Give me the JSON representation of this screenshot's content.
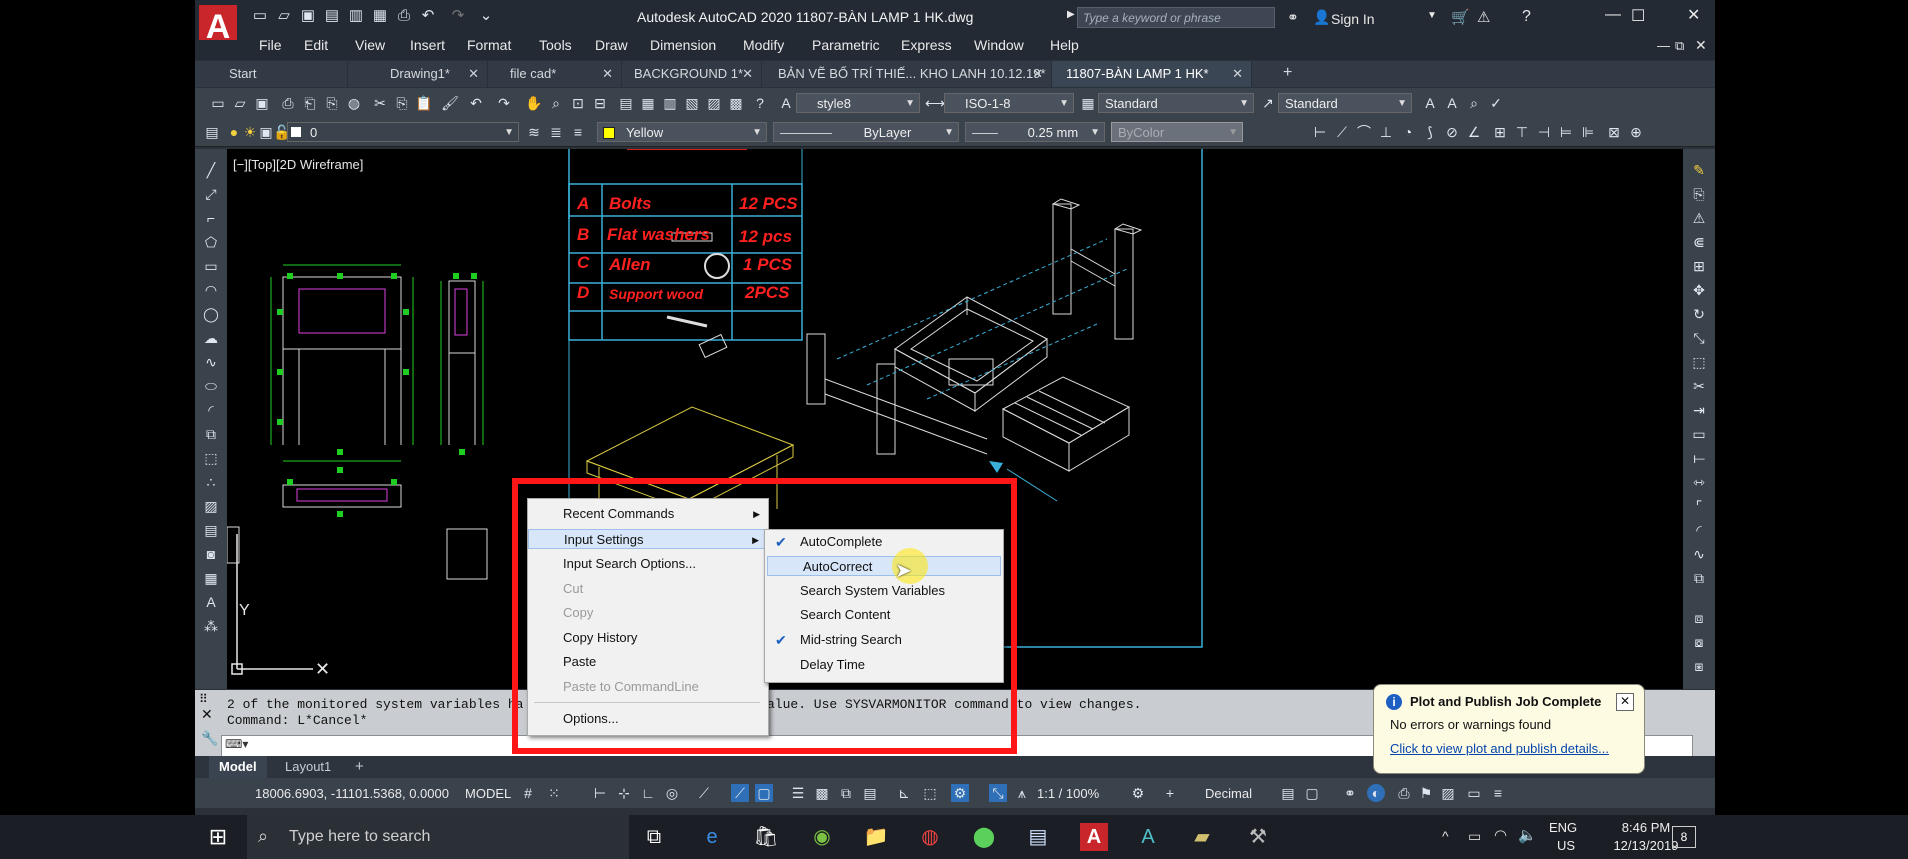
{
  "window": {
    "title": "Autodesk AutoCAD 2020    11807-BÀN LAMP 1 HK.dwg",
    "search_placeholder": "Type a keyword or phrase",
    "sign_in": "Sign In"
  },
  "menu": [
    "File",
    "Edit",
    "View",
    "Insert",
    "Format",
    "Tools",
    "Draw",
    "Dimension",
    "Modify",
    "Parametric",
    "Express",
    "Window",
    "Help"
  ],
  "doc_tabs": [
    {
      "label": "Start"
    },
    {
      "label": "Drawing1*"
    },
    {
      "label": "file cad*"
    },
    {
      "label": "BACKGROUND 1*"
    },
    {
      "label": "BẢN VẼ BỐ TRÍ THIẾ... KHO LANH 10.12.19*"
    },
    {
      "label": "11807-BÀN LAMP 1 HK*"
    }
  ],
  "toolbar": {
    "text_style": "style8",
    "dim_style": "ISO-1-8",
    "table_style": "Standard",
    "multileader_style": "Standard",
    "layer": "0",
    "color": "Yellow",
    "linetype": "ByLayer",
    "lineweight": "0.25 mm",
    "plotstyle": "ByColor"
  },
  "viewport_label": "[−][Top][2D Wireframe]",
  "parts_table": [
    {
      "key": "A",
      "name": "Bolts",
      "qty": "12 PCS"
    },
    {
      "key": "B",
      "name": "Flat washers",
      "qty": "12 pcs"
    },
    {
      "key": "C",
      "name": "Allen",
      "qty": "1 PCS"
    },
    {
      "key": "D",
      "name": "Support wood",
      "qty": "2PCS"
    }
  ],
  "context_menu": {
    "items": [
      {
        "label": "Recent Commands",
        "submenu": true
      },
      {
        "label": "Input Settings",
        "submenu": true
      },
      {
        "label": "Input Search Options..."
      },
      {
        "label": "Cut",
        "disabled": true
      },
      {
        "label": "Copy",
        "disabled": true
      },
      {
        "label": "Copy History"
      },
      {
        "label": "Paste"
      },
      {
        "label": "Paste to CommandLine",
        "disabled": true
      },
      {
        "label": "Options..."
      }
    ],
    "submenu": [
      {
        "label": "AutoComplete",
        "checked": true
      },
      {
        "label": "AutoCorrect",
        "highlighted": true
      },
      {
        "label": "Search System Variables"
      },
      {
        "label": "Search Content"
      },
      {
        "label": "Mid-string Search",
        "checked": true
      },
      {
        "label": "Delay Time"
      }
    ]
  },
  "command_line": {
    "line1a": "2 of the monitored system variables ha",
    "line1b": "alue. Use SYSVARMONITOR command to view changes.",
    "line2": "Command: L*Cancel*"
  },
  "layout_tabs": [
    "Model",
    "Layout1"
  ],
  "status": {
    "coordinates": "18006.6903, -11101.5368, 0.0000",
    "space": "MODEL",
    "scale": "1:1 / 100%",
    "units": "Decimal"
  },
  "notification": {
    "title": "Plot and Publish Job Complete",
    "text": "No errors or warnings found",
    "link": "Click to view plot and publish details..."
  },
  "taskbar": {
    "search_placeholder": "Type here to search",
    "lang1": "ENG",
    "lang2": "US",
    "time": "8:46 PM",
    "date": "12/13/2019",
    "notif_count": "8"
  }
}
